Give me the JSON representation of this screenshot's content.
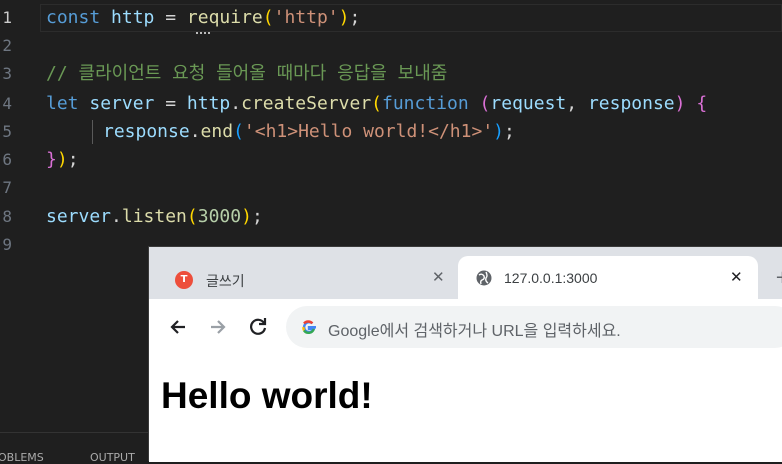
{
  "editor": {
    "line_numbers": [
      "1",
      "2",
      "3",
      "4",
      "5",
      "6",
      "7",
      "8",
      "9"
    ],
    "lines": {
      "l1": {
        "t1": "const",
        "t2": " ",
        "t3": "http",
        "t4": " = ",
        "t5": "require",
        "t6": "(",
        "t7": "'http'",
        "t8": ")",
        "t9": ";"
      },
      "l3": {
        "t1": "// 클라이언트 요청 들어올 때마다 응답을 보내줌"
      },
      "l4": {
        "t1": "let",
        "t2": " ",
        "t3": "server",
        "t4": " = ",
        "t5": "http",
        "t6": ".",
        "t7": "createServer",
        "t8": "(",
        "t9": "function",
        "t10": " ",
        "t11": "(",
        "t12": "request",
        "t13": ", ",
        "t14": "response",
        "t15": ")",
        "t16": " ",
        "t17": "{"
      },
      "l5": {
        "t1": "response",
        "t2": ".",
        "t3": "end",
        "t4": "(",
        "t5": "'<h1>Hello world!</h1>'",
        "t6": ")",
        "t7": ";"
      },
      "l6": {
        "t1": "}",
        "t2": ")",
        "t3": ";"
      },
      "l8": {
        "t1": "server",
        "t2": ".",
        "t3": "listen",
        "t4": "(",
        "t5": "3000",
        "t6": ")",
        "t7": ";"
      }
    },
    "panel_tabs": [
      "OBLEMS",
      "OUTPUT"
    ]
  },
  "browser": {
    "tabs": [
      {
        "title": "글쓰기",
        "favicon": "tistory-icon"
      },
      {
        "title": "127.0.0.1:3000",
        "favicon": "globe-icon"
      }
    ],
    "omnibox_placeholder": "Google에서 검색하거나 URL을 입력하세요.",
    "page_heading": "Hello world!"
  },
  "colors": {
    "editor_bg": "#1f1f1f",
    "keyword": "#569cd6",
    "string": "#ce9178",
    "comment": "#6a9955",
    "tab_favicon": "#ed4e3b"
  }
}
